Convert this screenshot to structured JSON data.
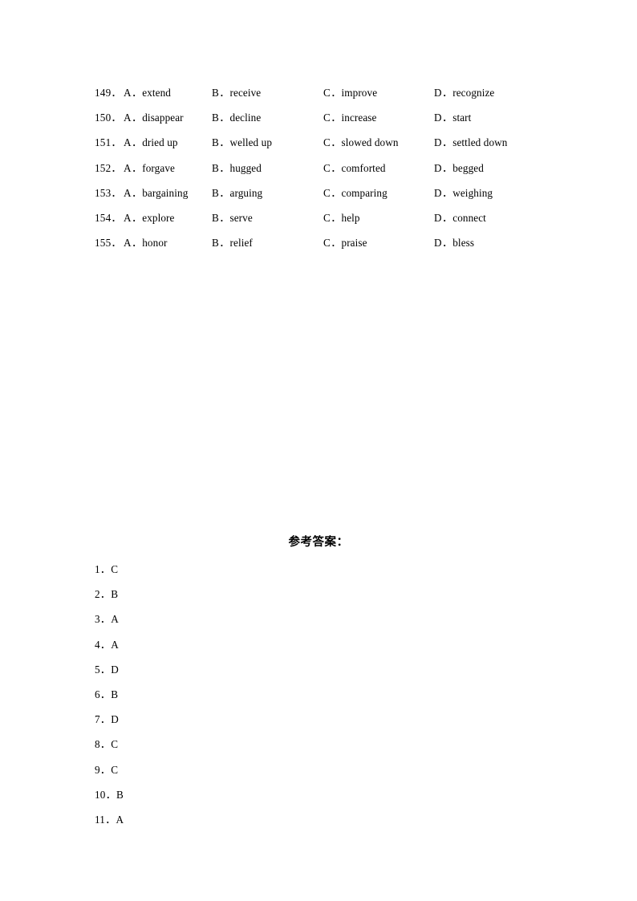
{
  "document": {
    "type": "exam-worksheet-page",
    "background_color": "#ffffff",
    "text_color": "#000000"
  },
  "questions": {
    "option_letters": [
      "A",
      "B",
      "C",
      "D"
    ],
    "separator": "．",
    "rows": [
      {
        "number": "149．",
        "a": "extend",
        "b": "receive",
        "c": "improve",
        "d": "recognize"
      },
      {
        "number": "150．",
        "a": "disappear",
        "b": "decline",
        "c": "increase",
        "d": "start"
      },
      {
        "number": "151．",
        "a": "dried up",
        "b": "welled up",
        "c": "slowed down",
        "d": "settled down"
      },
      {
        "number": "152．",
        "a": "forgave",
        "b": "hugged",
        "c": "comforted",
        "d": "begged"
      },
      {
        "number": "153．",
        "a": "bargaining",
        "b": "arguing",
        "c": "comparing",
        "d": "weighing"
      },
      {
        "number": "154．",
        "a": "explore",
        "b": "serve",
        "c": "help",
        "d": "connect"
      },
      {
        "number": "155．",
        "a": "honor",
        "b": "relief",
        "c": "praise",
        "d": "bless"
      }
    ]
  },
  "answer_key": {
    "heading": "参考答案：",
    "items": [
      {
        "number": "1．",
        "answer": "C"
      },
      {
        "number": "2．",
        "answer": "B"
      },
      {
        "number": "3．",
        "answer": "A"
      },
      {
        "number": "4．",
        "answer": "A"
      },
      {
        "number": "5．",
        "answer": "D"
      },
      {
        "number": "6．",
        "answer": "B"
      },
      {
        "number": "7．",
        "answer": "D"
      },
      {
        "number": "8．",
        "answer": "C"
      },
      {
        "number": "9．",
        "answer": "C"
      },
      {
        "number": "10．",
        "answer": "B"
      },
      {
        "number": "11．",
        "answer": "A"
      }
    ]
  }
}
